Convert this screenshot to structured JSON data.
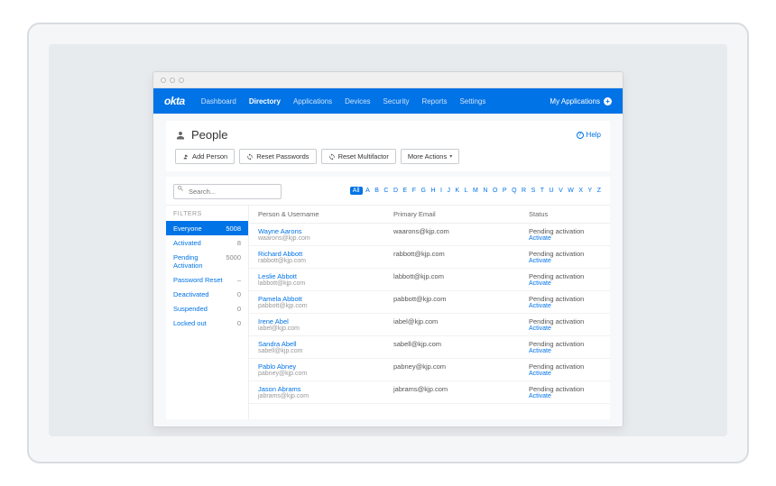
{
  "brand": "okta",
  "nav": {
    "items": [
      "Dashboard",
      "Directory",
      "Applications",
      "Devices",
      "Security",
      "Reports",
      "Settings"
    ],
    "activeIndex": 1,
    "myApps": "My Applications"
  },
  "page": {
    "title": "People",
    "help": "Help"
  },
  "toolbar": {
    "addPerson": "Add Person",
    "resetPasswords": "Reset Passwords",
    "resetMultifactor": "Reset Multifactor",
    "moreActions": "More Actions"
  },
  "search": {
    "placeholder": "Search..."
  },
  "alpha": {
    "all": "All",
    "letters": [
      "A",
      "B",
      "C",
      "D",
      "E",
      "F",
      "G",
      "H",
      "I",
      "J",
      "K",
      "L",
      "M",
      "N",
      "O",
      "P",
      "Q",
      "R",
      "S",
      "T",
      "U",
      "V",
      "W",
      "X",
      "Y",
      "Z"
    ]
  },
  "filters": {
    "title": "FILTERS",
    "items": [
      {
        "label": "Everyone",
        "count": "5008",
        "selected": true
      },
      {
        "label": "Activated",
        "count": "8",
        "selected": false
      },
      {
        "label": "Pending Activation",
        "count": "5000",
        "selected": false
      },
      {
        "label": "Password Reset",
        "count": "–",
        "selected": false
      },
      {
        "label": "Deactivated",
        "count": "0",
        "selected": false
      },
      {
        "label": "Suspended",
        "count": "0",
        "selected": false
      },
      {
        "label": "Locked out",
        "count": "0",
        "selected": false
      }
    ]
  },
  "table": {
    "headers": {
      "person": "Person & Username",
      "email": "Primary Email",
      "status": "Status"
    },
    "rows": [
      {
        "name": "Wayne Aarons",
        "username": "waarons@kjp.com",
        "email": "waarons@kjp.com",
        "status": "Pending activation",
        "action": "Activate"
      },
      {
        "name": "Richard Abbott",
        "username": "rabbott@kjp.com",
        "email": "rabbott@kjp.com",
        "status": "Pending activation",
        "action": "Activate"
      },
      {
        "name": "Leslie Abbott",
        "username": "labbott@kjp.com",
        "email": "labbott@kjp.com",
        "status": "Pending activation",
        "action": "Activate"
      },
      {
        "name": "Pamela Abbott",
        "username": "pabbott@kjp.com",
        "email": "pabbott@kjp.com",
        "status": "Pending activation",
        "action": "Activate"
      },
      {
        "name": "Irene Abel",
        "username": "iabel@kjp.com",
        "email": "iabel@kjp.com",
        "status": "Pending activation",
        "action": "Activate"
      },
      {
        "name": "Sandra Abell",
        "username": "sabell@kjp.com",
        "email": "sabell@kjp.com",
        "status": "Pending activation",
        "action": "Activate"
      },
      {
        "name": "Pablo Abney",
        "username": "pabney@kjp.com",
        "email": "pabney@kjp.com",
        "status": "Pending activation",
        "action": "Activate"
      },
      {
        "name": "Jason Abrams",
        "username": "jabrams@kjp.com",
        "email": "jabrams@kjp.com",
        "status": "Pending activation",
        "action": "Activate"
      }
    ]
  }
}
